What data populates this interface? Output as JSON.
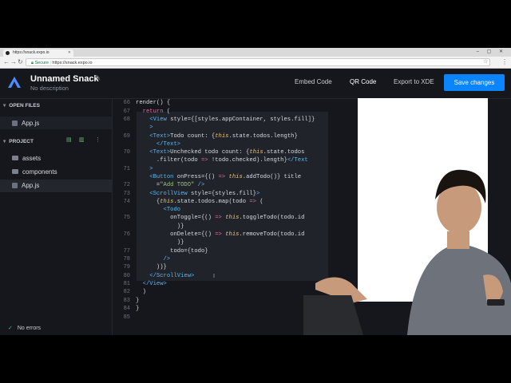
{
  "browser": {
    "tab_title": "https://snack.expo.io",
    "secure_label": "Secure",
    "url": "https://snack.expo.io"
  },
  "header": {
    "title": "Unnamed Snack",
    "description": "No description",
    "embed_code": "Embed Code",
    "qr_code": "QR Code",
    "export": "Export to XDE",
    "save": "Save changes"
  },
  "sidebar": {
    "open_files_label": "OPEN FILES",
    "open_file": "App.js",
    "project_label": "PROJECT",
    "items": [
      "assets",
      "components",
      "App.js"
    ]
  },
  "status": {
    "text": "No errors"
  },
  "editor": {
    "line_numbers": [
      "66",
      "67",
      "68",
      "",
      "69",
      "",
      "70",
      "",
      "71",
      "",
      "72",
      "73",
      "74",
      "",
      "75",
      "",
      "76",
      "",
      "77",
      "78",
      "79",
      "80",
      "81",
      "82",
      "83",
      "84",
      "85"
    ]
  },
  "colors": {
    "accent": "#0a84ff",
    "background": "#15171c"
  }
}
